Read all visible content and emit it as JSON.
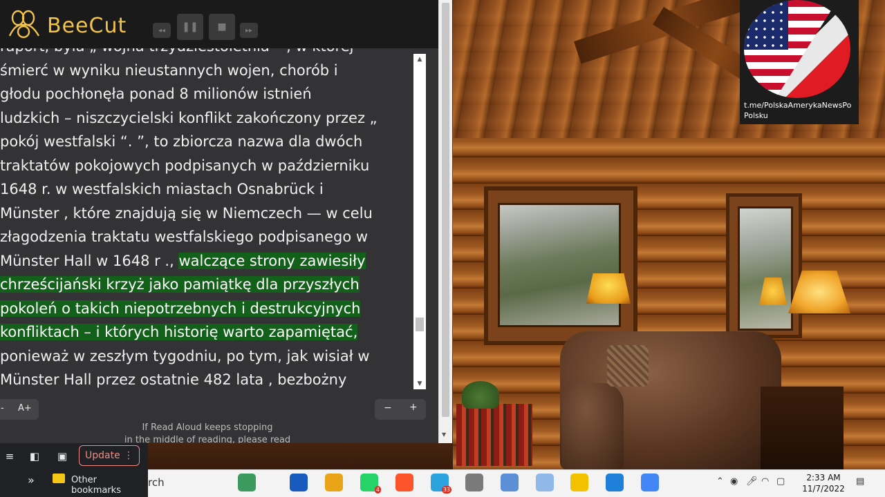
{
  "recorder": {
    "brand": "BeeCut",
    "controls": [
      "rewind",
      "pause",
      "stop",
      "forward"
    ]
  },
  "overlay": {
    "channel_line1": "t.me/PolskaAmerykaNewsPo",
    "channel_line2": "Polsku"
  },
  "reader": {
    "lines": [
      {
        "text": "raport, była „ wojna trzydziestoletnia ” , w której",
        "highlight": ""
      },
      {
        "text": "śmierć w wyniku nieustannych wojen, chorób i",
        "highlight": ""
      },
      {
        "text": "głodu pochłonęła ponad 8 milionów istnień",
        "highlight": ""
      },
      {
        "text": "ludzkich – niszczycielski konflikt zakończony przez „",
        "highlight": ""
      },
      {
        "text": "pokój westfalski “. ”, to zbiorcza nazwa dla dwóch",
        "highlight": ""
      },
      {
        "text": "traktatów pokojowych podpisanych w październiku",
        "highlight": ""
      },
      {
        "text": "1648 r. w westfalskich miastach Osnabrück i",
        "highlight": ""
      },
      {
        "text": "Münster , które znajdują się w Niemczech — w celu",
        "highlight": ""
      },
      {
        "text": "złagodzenia traktatu westfalskiego podpisanego w",
        "highlight": ""
      },
      {
        "text": "Münster Hall w 1648 r ., ",
        "highlight": "walczące strony zawiesiły"
      },
      {
        "text": "",
        "highlight": "chrześcijański krzyż jako pamiątkę dla przyszłych"
      },
      {
        "text": "",
        "highlight": "pokoleń o takich niepotrzebnych i destrukcyjnych"
      },
      {
        "text": "",
        "highlight": "konfliktach – i których historię warto zapamiętać,"
      },
      {
        "text": "ponieważ w zeszłym tygodniu, po tym, jak wisiał w",
        "highlight": ""
      },
      {
        "text": "Münster Hall przez ostatnie 482 lata , bezbożny",
        "highlight": ""
      }
    ],
    "font_decrease": "-",
    "font_increase": "A+",
    "zoom_out": "−",
    "zoom_in": "+",
    "notice": "If Read Aloud keeps stopping",
    "notice_cont": "in the middle of reading, please read"
  },
  "browser": {
    "update_label": "Update",
    "bookmarks_chevron": "»",
    "other_bookmarks": "Other bookmarks"
  },
  "taskbar": {
    "search_partial": "rch",
    "apps": [
      {
        "name": "chemistry-app",
        "color": "#3c9a5f",
        "badge": ""
      },
      {
        "name": "word",
        "color": "#185abd",
        "badge": ""
      },
      {
        "name": "file-explorer",
        "color": "#e8a317",
        "badge": ""
      },
      {
        "name": "whatsapp",
        "color": "#25d366",
        "badge": "4"
      },
      {
        "name": "brave",
        "color": "#fb542b",
        "badge": ""
      },
      {
        "name": "telegram",
        "color": "#2aa3df",
        "badge": "33"
      },
      {
        "name": "paint-tool",
        "color": "#7a7a7a",
        "badge": ""
      },
      {
        "name": "notepad",
        "color": "#5b8fd6",
        "badge": ""
      },
      {
        "name": "notes",
        "color": "#8fb7e8",
        "badge": ""
      },
      {
        "name": "beecut",
        "color": "#f2c200",
        "badge": ""
      },
      {
        "name": "media-player",
        "color": "#1e7fd8",
        "badge": ""
      },
      {
        "name": "chrome",
        "color": "#4285f4",
        "badge": ""
      }
    ],
    "time": "2:33 AM",
    "date": "11/7/2022"
  }
}
